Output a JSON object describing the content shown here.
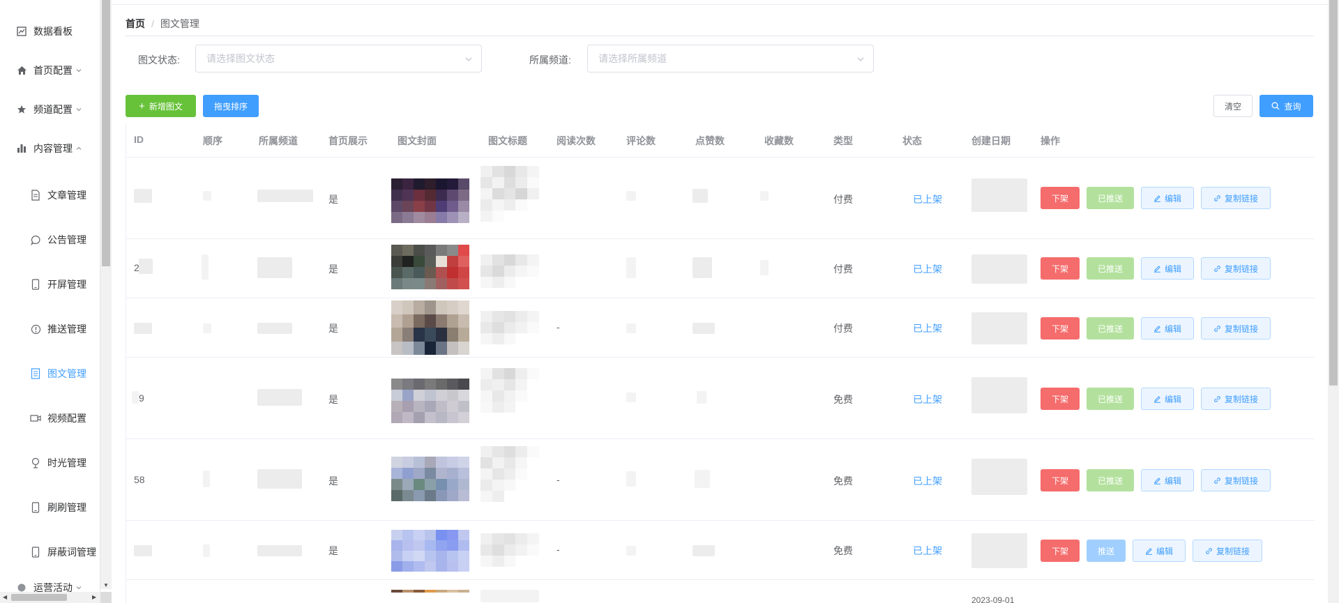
{
  "sidebar": {
    "items": [
      {
        "label": "数据看板",
        "icon": "chart-icon"
      },
      {
        "label": "首页配置",
        "icon": "home-icon"
      },
      {
        "label": "频道配置",
        "icon": "star-icon"
      },
      {
        "label": "内容管理",
        "icon": "bar-chart-icon"
      },
      {
        "label": "文章管理",
        "icon": "document-icon"
      },
      {
        "label": "公告管理",
        "icon": "chat-bubble-icon"
      },
      {
        "label": "开屏管理",
        "icon": "mobile-icon"
      },
      {
        "label": "推送管理",
        "icon": "info-circle-icon"
      },
      {
        "label": "图文管理",
        "icon": "tickets-icon"
      },
      {
        "label": "视频配置",
        "icon": "video-camera-icon"
      },
      {
        "label": "时光管理",
        "icon": "ice-cream-icon"
      },
      {
        "label": "刷刷管理",
        "icon": "mobile-icon"
      },
      {
        "label": "屏蔽词管理",
        "icon": "mobile-icon"
      },
      {
        "label": "运营活动",
        "icon": "circle-icon"
      }
    ]
  },
  "breadcrumb": {
    "home": "首页",
    "separator": "/",
    "current": "图文管理"
  },
  "filters": {
    "status_label": "图文状态:",
    "status_placeholder": "请选择图文状态",
    "channel_label": "所属频道:",
    "channel_placeholder": "请选择所属频道"
  },
  "toolbar": {
    "add_label": "新增图文",
    "sort_label": "拖曳排序",
    "clear_label": "清空",
    "query_label": "查询"
  },
  "table": {
    "columns": [
      "ID",
      "顺序",
      "所属频道",
      "首页展示",
      "图文封面",
      "图文标题",
      "阅读次数",
      "评论数",
      "点赞数",
      "收藏数",
      "类型",
      "状态",
      "创建日期",
      "操作"
    ],
    "rows": [
      {
        "id": "",
        "read": "",
        "home": "是",
        "type": "付费",
        "status": "已上架",
        "push": "已推送"
      },
      {
        "id": "2",
        "read": "",
        "home": "是",
        "type": "付费",
        "status": "已上架",
        "push": "已推送"
      },
      {
        "id": "",
        "read": "-",
        "home": "是",
        "type": "付费",
        "status": "已上架",
        "push": "已推送"
      },
      {
        "id": "9",
        "read": "",
        "home": "是",
        "type": "免费",
        "status": "已上架",
        "push": "已推送"
      },
      {
        "id": "58",
        "read": "-",
        "home": "是",
        "type": "免费",
        "status": "已上架",
        "push": "已推送"
      },
      {
        "id": "",
        "read": "-",
        "home": "是",
        "type": "免费",
        "status": "已上架",
        "push": "推送"
      }
    ],
    "partial_date": "2023-09-01",
    "actions": {
      "off_label": "下架",
      "edit_label": "编辑",
      "copy_label": "复制链接"
    }
  },
  "colors": {
    "primary": "#409eff",
    "success": "#67c23a",
    "danger": "#f56c6c",
    "success_light": "#b3e19d",
    "primary_light": "#a0cfff"
  }
}
